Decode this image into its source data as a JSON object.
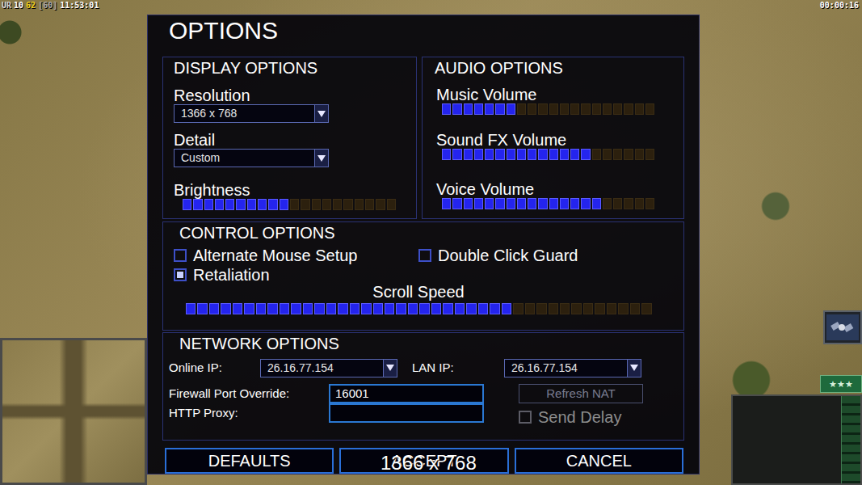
{
  "hud": {
    "stats": [
      {
        "text": "UR",
        "color": "#d8d8d8"
      },
      {
        "text": "10",
        "color": "#ffffff"
      },
      {
        "text": "62",
        "color": "#f2d21e"
      },
      {
        "text": "[60]",
        "color": "#a8a8a8"
      },
      {
        "text": "11:53:01",
        "color": "#ffffff"
      }
    ],
    "timer": "00:00:16"
  },
  "rank_button": "★★★",
  "dialog": {
    "title": "OPTIONS",
    "display": {
      "title": "DISPLAY OPTIONS",
      "fields": [
        {
          "label": "Resolution",
          "value": "1366 x 768"
        },
        {
          "label": "Detail",
          "value": "Custom"
        }
      ],
      "brightness": {
        "label": "Brightness",
        "level": 0.5
      }
    },
    "audio": {
      "title": "AUDIO OPTIONS",
      "sliders": [
        {
          "label": "Music Volume",
          "level": 0.35
        },
        {
          "label": "Sound FX Volume",
          "level": 0.7
        },
        {
          "label": "Voice Volume",
          "level": 0.75
        }
      ]
    },
    "control": {
      "title": "CONTROL OPTIONS",
      "checkboxes": [
        {
          "label": "Alternate Mouse Setup",
          "checked": false
        },
        {
          "label": "Double Click Guard",
          "checked": false
        },
        {
          "label": "Retaliation",
          "checked": true
        }
      ],
      "scroll": {
        "label": "Scroll Speed",
        "level": 0.7
      }
    },
    "network": {
      "title": "NETWORK OPTIONS",
      "online_ip": {
        "label": "Online IP:",
        "value": "26.16.77.154"
      },
      "lan_ip": {
        "label": "LAN IP:",
        "value": "26.16.77.154"
      },
      "firewall": {
        "label": "Firewall Port Override:",
        "value": "16001"
      },
      "proxy": {
        "label": "HTTP Proxy:",
        "value": ""
      },
      "refresh_nat": {
        "label": "Refresh NAT",
        "disabled": true
      },
      "send_delay": {
        "label": "Send Delay",
        "checked": false,
        "disabled": true
      }
    },
    "buttons": [
      "DEFAULTS",
      "ACCEPT",
      "CANCEL"
    ],
    "tooltip": "1366 x 768"
  }
}
